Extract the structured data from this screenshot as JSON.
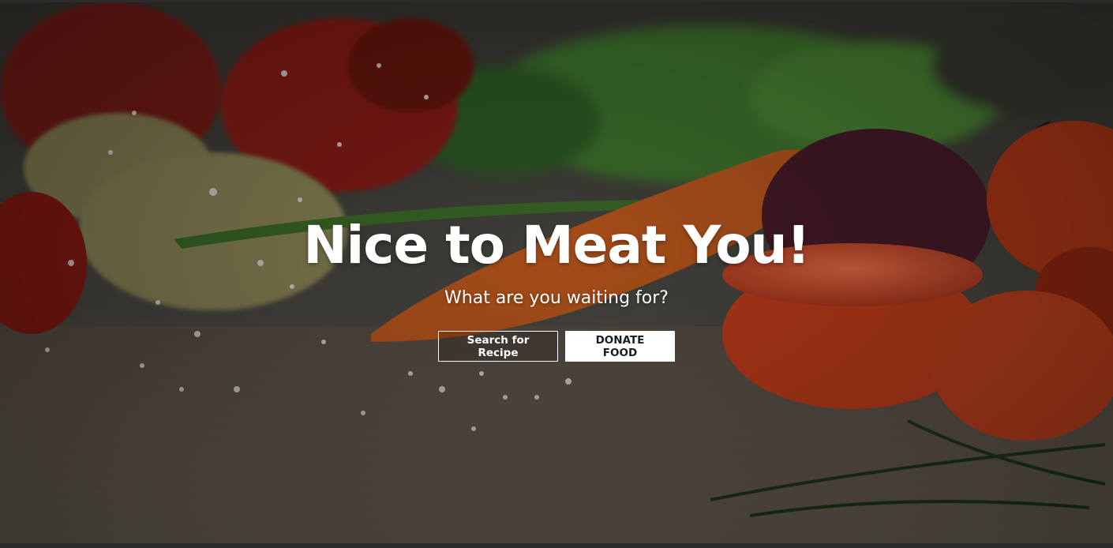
{
  "hero": {
    "title": "Nice to Meat You!",
    "subtitle": "What are you waiting for?",
    "search_button": "Search for Recipe",
    "donate_button": "DONATE FOOD",
    "background_image": "vegetables-on-cutting-board"
  },
  "colors": {
    "text": "#ffffff",
    "button_solid_bg": "#ffffff",
    "button_solid_text": "#1c1c1c"
  }
}
